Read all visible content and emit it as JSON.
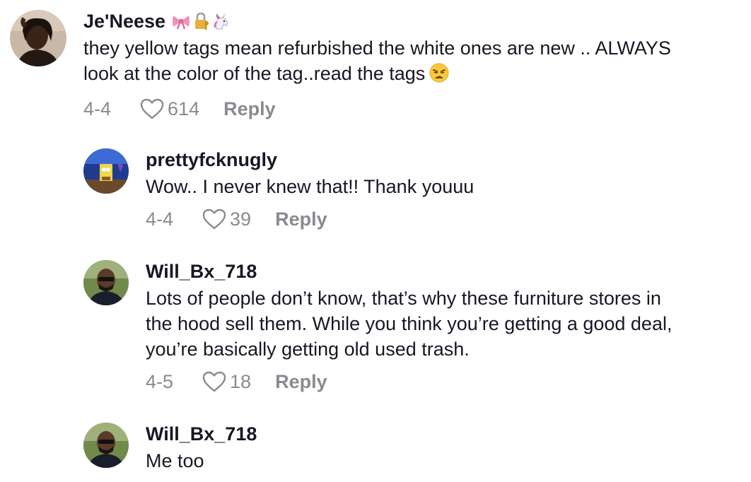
{
  "comments": [
    {
      "username": "Je'Neese",
      "badges": [
        "bow-icon",
        "lock-key-icon",
        "unicorn-icon"
      ],
      "text_line1": "they yellow tags mean refurbished the white ones are new .. ALWAYS",
      "text_line2": "look at the color of the tag..read the tags",
      "date": "4-4",
      "likes": "614",
      "reply_label": "Reply"
    },
    {
      "username": "prettyfcknugly",
      "text_line1": "Wow.. I never knew that!! Thank youuu",
      "date": "4-4",
      "likes": "39",
      "reply_label": "Reply"
    },
    {
      "username": "Will_Bx_718",
      "text_line1": "Lots of people don’t know, that’s why these furniture stores in",
      "text_line2": "the hood sell them. While you think you’re getting a good deal,",
      "text_line3": "you’re basically getting old used trash.",
      "date": "4-5",
      "likes": "18",
      "reply_label": "Reply"
    },
    {
      "username": "Will_Bx_718",
      "text_line1": "Me too"
    }
  ],
  "colors": {
    "text": "#161823",
    "muted": "#8a8b91",
    "background": "#ffffff"
  }
}
